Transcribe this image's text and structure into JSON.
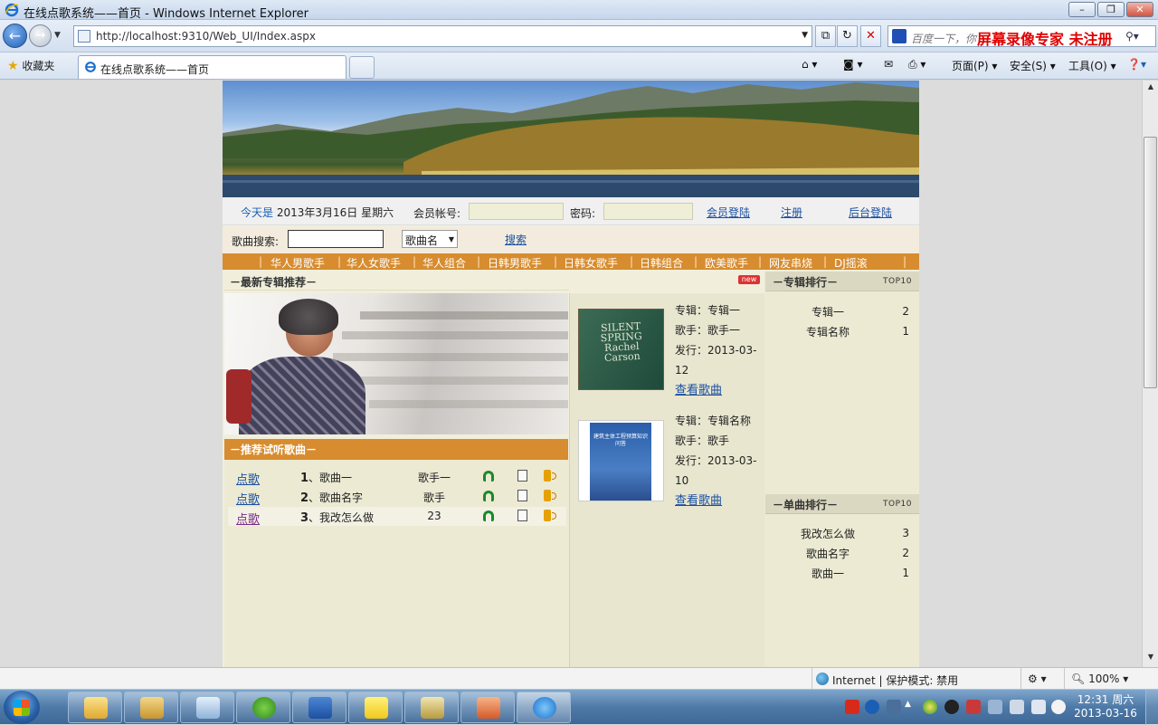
{
  "window": {
    "title": "在线点歌系统——首页 - Windows Internet Explorer",
    "url": "http://localhost:9310/Web_UI/Index.aspx",
    "search_placeholder": "百度一下，你",
    "watermark": "屏幕录像专家 未注册",
    "favorites_label": "收藏夹",
    "tab_title": "在线点歌系统——首页",
    "commands": [
      "页面(P)",
      "安全(S)",
      "工具(O)"
    ]
  },
  "login": {
    "today_label": "今天是",
    "date": "2013年3月16日 星期六",
    "account_label": "会员帐号:",
    "password_label": "密码:",
    "login_link": "会员登陆",
    "register_link": "注册",
    "admin_link": "后台登陆"
  },
  "search": {
    "label": "歌曲搜索:",
    "select_value": "歌曲名",
    "button": "搜索"
  },
  "categories": [
    "华人男歌手",
    "华人女歌手",
    "华人组合",
    "日韩男歌手",
    "日韩女歌手",
    "日韩组合",
    "欧美歌手",
    "网友串烧",
    "DJ摇滚"
  ],
  "album_section": {
    "title": "－最新专辑推荐－",
    "new_tag": "new",
    "albums": [
      {
        "name": "专辑：专辑一",
        "singer": "歌手：歌手一",
        "release1": "发行：2013-03-",
        "release2": "12",
        "link": "查看歌曲",
        "cover_text": "SILENT SPRING Rachel Carson"
      },
      {
        "name": "专辑：专辑名称",
        "singer": "歌手：歌手",
        "release1": "发行：2013-03-",
        "release2": "10",
        "link": "查看歌曲",
        "cover_text": "建筑主体工程预算知识问答"
      }
    ]
  },
  "recommend": {
    "title": "－推荐试听歌曲－",
    "songs": [
      {
        "action": "点歌",
        "index": "1",
        "name": "、歌曲一",
        "singer": "歌手一"
      },
      {
        "action": "点歌",
        "index": "2",
        "name": "、歌曲名字",
        "singer": "歌手"
      },
      {
        "action": "点歌",
        "index": "3",
        "name": "、我改怎么做",
        "singer": "23"
      }
    ]
  },
  "album_rank": {
    "title": "－专辑排行－",
    "badge": "TOP10",
    "items": [
      {
        "name": "专辑一",
        "count": "2"
      },
      {
        "name": "专辑名称",
        "count": "1"
      }
    ]
  },
  "song_rank": {
    "title": "－单曲排行－",
    "badge": "TOP10",
    "items": [
      {
        "name": "我改怎么做",
        "count": "3"
      },
      {
        "name": "歌曲名字",
        "count": "2"
      },
      {
        "name": "歌曲一",
        "count": "1"
      }
    ]
  },
  "status": {
    "zone": "Internet | 保护模式: 禁用",
    "zoom": "100%"
  },
  "clock": {
    "time": "12:31 周六",
    "date": "2013-03-16"
  },
  "colors": {
    "orange_bar": "#d78c2f",
    "link_blue": "#1a4fa0",
    "panel_bg": "#ecead3"
  }
}
